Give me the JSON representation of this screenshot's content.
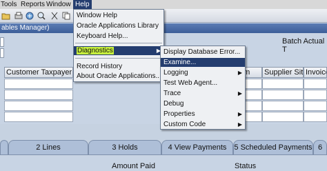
{
  "menubar": {
    "items": [
      "Tools",
      "Reports",
      "Window",
      "Help"
    ],
    "active": "Help"
  },
  "window": {
    "title_fragment": "ables Manager)"
  },
  "form": {
    "batch_label": "Batch Actual T",
    "columns": [
      "Customer Taxpayer ID",
      "um",
      "Supplier Site",
      "Invoice"
    ]
  },
  "tabs": [
    {
      "label": "2 Lines"
    },
    {
      "label": "3 Holds"
    },
    {
      "label": "4 View Payments"
    },
    {
      "label": "5 Scheduled Payments"
    },
    {
      "label": "6"
    }
  ],
  "bottom": {
    "amount_paid": "Amount Paid",
    "status": "Status"
  },
  "help_menu": {
    "items": [
      {
        "label": "Window Help"
      },
      {
        "label": "Oracle Applications Library"
      },
      {
        "label": "Keyboard Help..."
      },
      {
        "label": "Diagnostics",
        "submenu": true,
        "highlighted": true
      },
      {
        "label": "Record History"
      },
      {
        "label": "About Oracle Applications..."
      }
    ]
  },
  "diagnostics_menu": {
    "items": [
      {
        "label": "Display Database Error..."
      },
      {
        "label": "Examine...",
        "highlighted": true
      },
      {
        "label": "Logging",
        "submenu": true
      },
      {
        "label": "Test Web Agent..."
      },
      {
        "label": "Trace",
        "submenu": true
      },
      {
        "label": "Debug"
      },
      {
        "label": "Properties",
        "submenu": true
      },
      {
        "label": "Custom Code",
        "submenu": true
      }
    ]
  },
  "colors": {
    "menu_highlight": "#243d6f",
    "diagnostics_text_highlight": "#c7ef3d",
    "title_bar": "#3d5f99",
    "form_bg": "#c8d4e4"
  }
}
